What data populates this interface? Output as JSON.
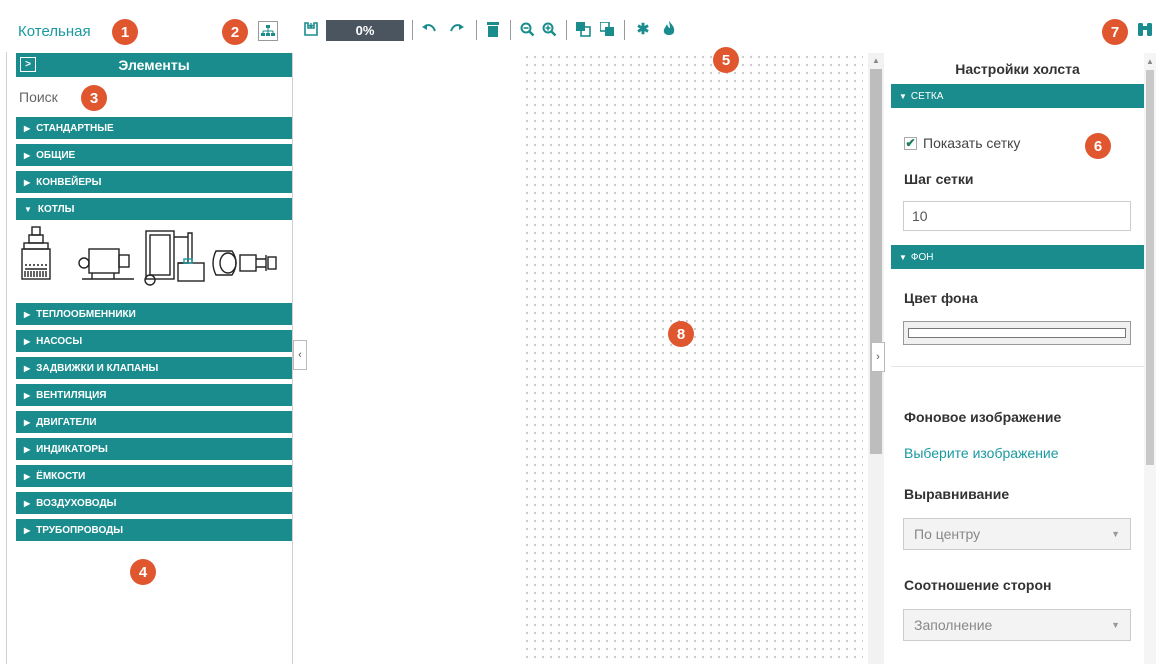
{
  "header": {
    "project_name": "Котельная",
    "progress": "0%",
    "badges": [
      "1",
      "2",
      "3",
      "4",
      "5",
      "6",
      "7",
      "8"
    ]
  },
  "toolbar": {
    "icons": [
      "save-icon",
      "undo-icon",
      "redo-icon",
      "delete-icon",
      "zoom-out-icon",
      "zoom-in-icon",
      "bring-front-icon",
      "send-back-icon",
      "snowflake-icon",
      "fire-icon",
      "binoculars-icon",
      "hierarchy-icon"
    ]
  },
  "elements_panel": {
    "expand_symbol": ">",
    "title": "Элементы",
    "search_placeholder": "Поиск",
    "categories": [
      {
        "label": "СТАНДАРТНЫЕ",
        "expanded": false
      },
      {
        "label": "ОБЩИЕ",
        "expanded": false
      },
      {
        "label": "КОНВЕЙЕРЫ",
        "expanded": false
      },
      {
        "label": "КОТЛЫ",
        "expanded": true
      },
      {
        "label": "ТЕПЛООБМЕННИКИ",
        "expanded": false
      },
      {
        "label": "НАСОСЫ",
        "expanded": false
      },
      {
        "label": "ЗАДВИЖКИ И КЛАПАНЫ",
        "expanded": false
      },
      {
        "label": "ВЕНТИЛЯЦИЯ",
        "expanded": false
      },
      {
        "label": "ДВИГАТЕЛИ",
        "expanded": false
      },
      {
        "label": "ИНДИКАТОРЫ",
        "expanded": false
      },
      {
        "label": "ЁМКОСТИ",
        "expanded": false
      },
      {
        "label": "ВОЗДУХОВОДЫ",
        "expanded": false
      },
      {
        "label": "ТРУБОПРОВОДЫ",
        "expanded": false
      }
    ]
  },
  "canvas_settings": {
    "title": "Настройки холста",
    "grid_section": "СЕТКА",
    "show_grid_label": "Показать сетку",
    "show_grid_checked": true,
    "grid_step_label": "Шаг сетки",
    "grid_step_value": "10",
    "background_section": "ФОН",
    "background_color_label": "Цвет фона",
    "background_image_label": "Фоновое изображение",
    "choose_image_link": "Выберите изображение",
    "alignment_label": "Выравнивание",
    "alignment_value": "По центру",
    "aspect_label": "Соотношение сторон",
    "aspect_value": "Заполнение"
  },
  "colors": {
    "accent": "#1a8c8e",
    "badge": "#e0562f",
    "progress_bg": "#4a5560"
  }
}
